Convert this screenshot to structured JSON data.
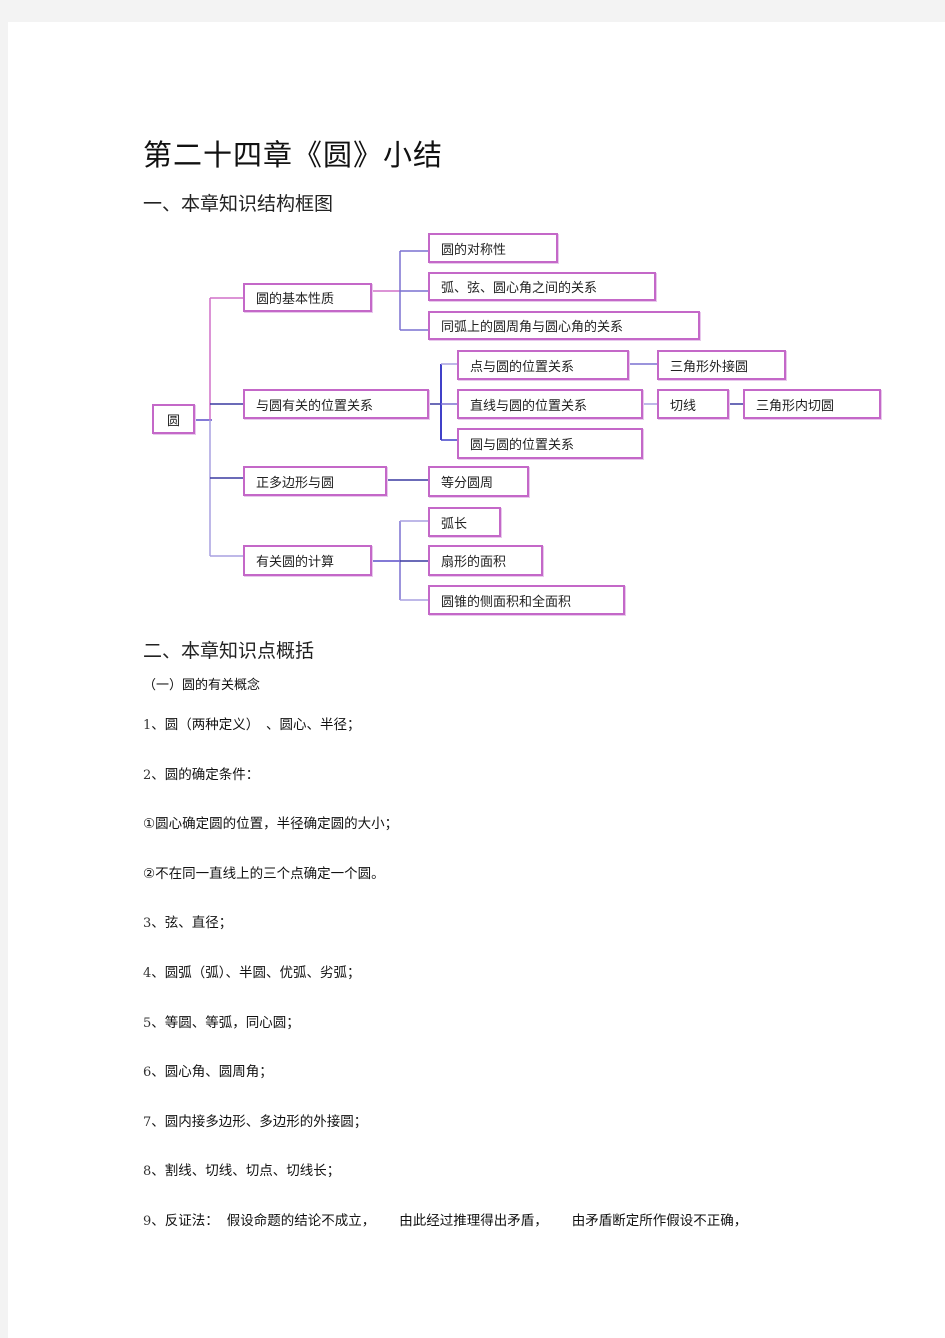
{
  "document": {
    "title": "第二十四章《圆》小结",
    "section1_heading": "一、本章知识结构框图",
    "section2_heading": "二、本章知识点概括",
    "subsection1": "（一）圆的有关概念"
  },
  "diagram": {
    "root": "圆",
    "branches": [
      {
        "label": "圆的基本性质",
        "children": [
          "圆的对称性",
          "弧、弦、圆心角之间的关系",
          "同弧上的圆周角与圆心角的关系"
        ]
      },
      {
        "label": "与圆有关的位置关系",
        "children": [
          "点与圆的位置关系",
          "直线与圆的位置关系",
          "圆与圆的位置关系"
        ],
        "grandchildren": {
          "point_circle": "三角形外接圆",
          "line_circle": "切线",
          "tangent": "三角形内切圆"
        }
      },
      {
        "label": "正多边形与圆",
        "children": [
          "等分圆周"
        ]
      },
      {
        "label": "有关圆的计算",
        "children": [
          "弧长",
          "扇形的面积",
          "圆锥的侧面积和全面积"
        ]
      }
    ],
    "colors": {
      "box_border": "#c468c8",
      "connector_pink": "#d070c8",
      "connector_blue": "#5a4fc8",
      "connector_lavender": "#a8a0e0"
    }
  },
  "items": [
    {
      "num": "1",
      "text": "、圆（两种定义）　、圆心、半径；"
    },
    {
      "num": "2",
      "text": "、圆的确定条件："
    },
    {
      "num": "",
      "text": "①圆心确定圆的位置，半径确定圆的大小；"
    },
    {
      "num": "",
      "text": "②不在同一直线上的三个点确定一个圆。"
    },
    {
      "num": "3",
      "text": "、弦、直径；"
    },
    {
      "num": "4",
      "text": "、圆弧（弧）、半圆、优弧、劣弧；"
    },
    {
      "num": "5",
      "text": "、等圆、等弧，同心圆；"
    },
    {
      "num": "6",
      "text": "、圆心角、圆周角；"
    },
    {
      "num": "7",
      "text": "、圆内接多边形、多边形的外接圆；"
    },
    {
      "num": "8",
      "text": "、割线、切线、切点、切线长；"
    },
    {
      "num": "9",
      "text": "、反证法：",
      "parts": [
        "假设命题的结论不成立，",
        "由此经过推理得出矛盾，",
        "由矛盾断定所作假设不正确，"
      ]
    }
  ]
}
